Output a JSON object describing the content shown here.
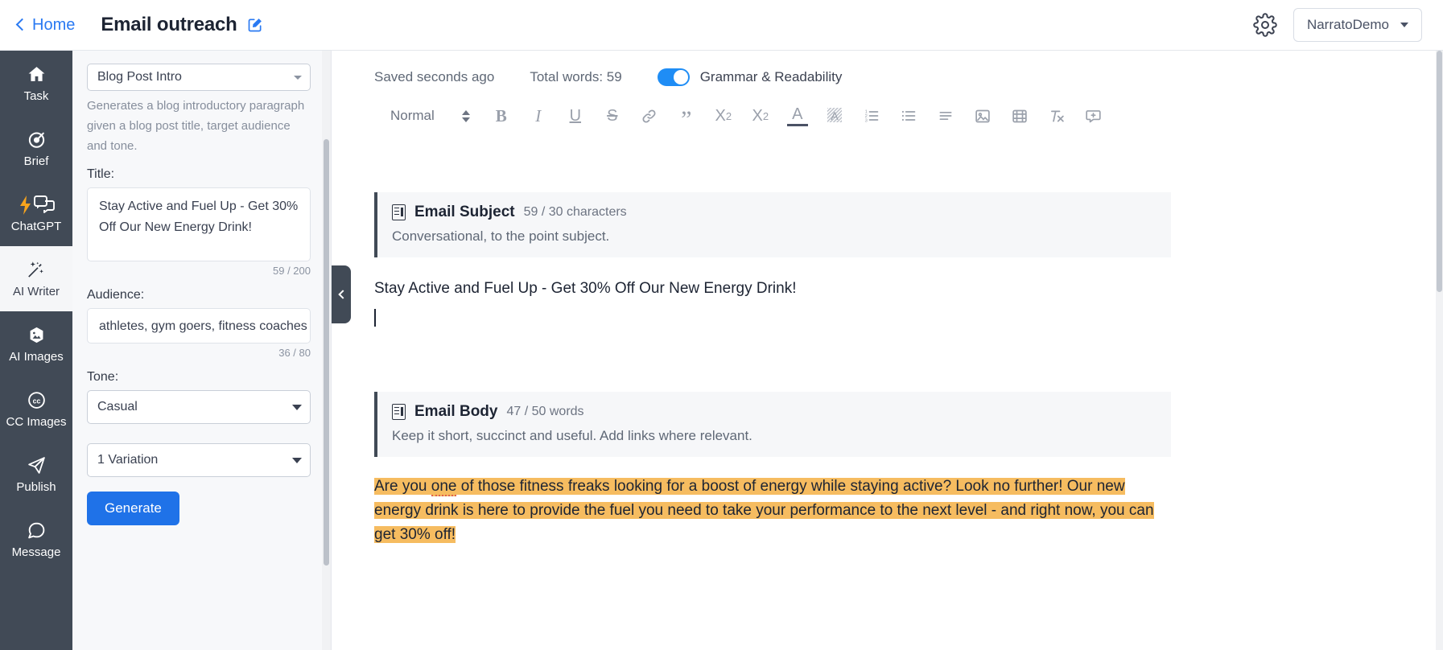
{
  "header": {
    "back_label": "Home",
    "doc_title": "Email outreach",
    "edit_icon": "edit-pencil-icon",
    "gear_icon": "gear-icon",
    "account_name": "NarratoDemo"
  },
  "rail": {
    "items": [
      {
        "label": "Task",
        "icon": "home-icon",
        "active": false
      },
      {
        "label": "Brief",
        "icon": "target-icon",
        "active": false
      },
      {
        "label": "ChatGPT",
        "icon": "chat-bolt-icon",
        "active": false
      },
      {
        "label": "AI Writer",
        "icon": "magic-wand-icon",
        "active": true
      },
      {
        "label": "AI Images",
        "icon": "image-hexagon-icon",
        "active": false
      },
      {
        "label": "CC Images",
        "icon": "creative-commons-icon",
        "active": false
      },
      {
        "label": "Publish",
        "icon": "paper-plane-icon",
        "active": false
      },
      {
        "label": "Message",
        "icon": "speech-bubble-icon",
        "active": false
      }
    ]
  },
  "panel": {
    "template_select": "Blog Post Intro",
    "template_description": "Generates a blog introductory paragraph given a blog post title, target audience and tone.",
    "title_label": "Title:",
    "title_value": "Stay Active and Fuel Up - Get 30% Off Our New Energy Drink!",
    "title_counter": "59 / 200",
    "audience_label": "Audience:",
    "audience_value": "athletes, gym goers, fitness coaches",
    "audience_counter": "36 / 80",
    "tone_label": "Tone:",
    "tone_value": "Casual",
    "variation_value": "1 Variation",
    "generate_label": "Generate"
  },
  "status": {
    "saved": "Saved seconds ago",
    "total_words": "Total words: 59",
    "grammar_label": "Grammar & Readability",
    "grammar_on": true
  },
  "toolbar": {
    "style_label": "Normal",
    "buttons": [
      {
        "name": "bold-icon",
        "glyph": "B"
      },
      {
        "name": "italic-icon",
        "glyph": "I"
      },
      {
        "name": "underline-icon",
        "glyph": "U"
      },
      {
        "name": "strikethrough-icon",
        "glyph": "S"
      },
      {
        "name": "link-icon",
        "glyph": "🔗"
      },
      {
        "name": "blockquote-icon",
        "glyph": "”"
      },
      {
        "name": "subscript-icon",
        "glyph": "X₂"
      },
      {
        "name": "superscript-icon",
        "glyph": "X²"
      },
      {
        "name": "text-color-icon",
        "glyph": "A"
      },
      {
        "name": "highlight-color-icon",
        "glyph": "A"
      },
      {
        "name": "ordered-list-icon",
        "glyph": ""
      },
      {
        "name": "bullet-list-icon",
        "glyph": ""
      },
      {
        "name": "align-icon",
        "glyph": ""
      },
      {
        "name": "insert-image-icon",
        "glyph": ""
      },
      {
        "name": "insert-video-icon",
        "glyph": ""
      },
      {
        "name": "clear-format-icon",
        "glyph": ""
      },
      {
        "name": "add-comment-icon",
        "glyph": ""
      }
    ]
  },
  "editor": {
    "subject_card": {
      "title": "Email Subject",
      "count": "59 / 30 characters",
      "subtitle": "Conversational, to the point subject."
    },
    "subject_text": "Stay Active and Fuel Up - Get 30% Off Our New Energy Drink!",
    "body_card": {
      "title": "Email Body",
      "count": "47 / 50 words",
      "subtitle": "Keep it short, succinct and useful. Add links where relevant."
    },
    "body_segment_1": "Are you ",
    "body_segment_spell": "one",
    "body_segment_2": " of those fitness freaks looking for a boost of energy while staying active? Look no further! Our new energy drink is here to provide the fuel you need to take your performance to the next level - and right now, you can get 30% off!"
  },
  "colors": {
    "accent_blue": "#1f72e8",
    "rail_dark": "#414a56",
    "highlight_orange": "#f6bc60",
    "toggle_blue": "#1f8df5"
  }
}
